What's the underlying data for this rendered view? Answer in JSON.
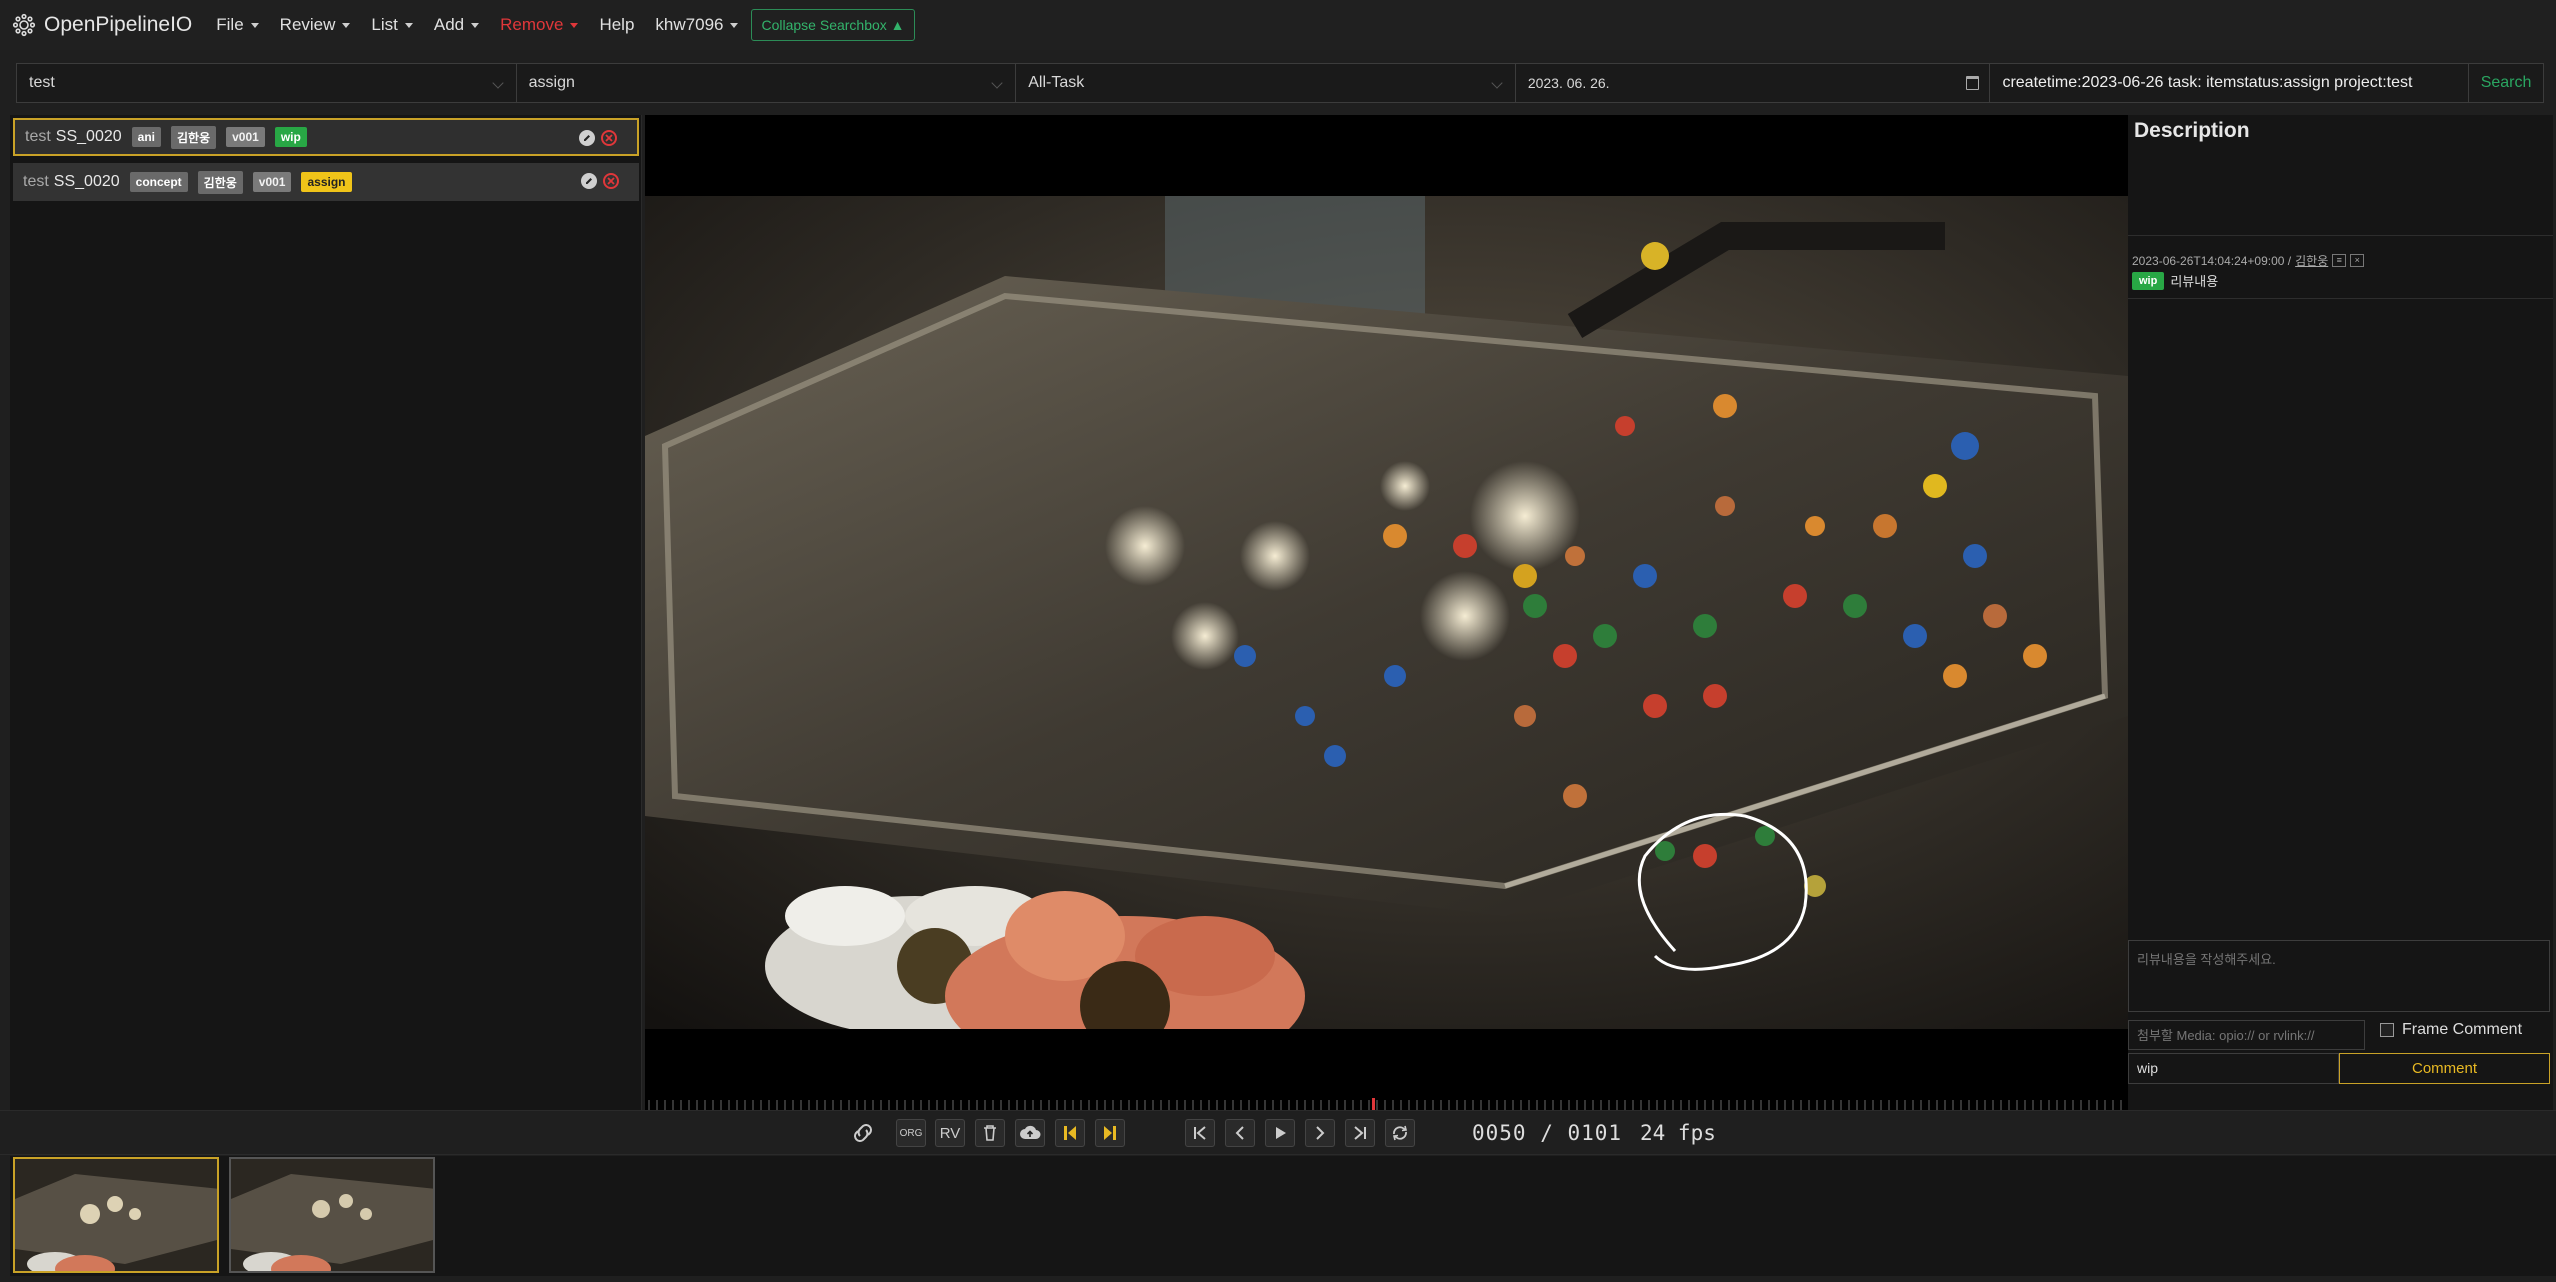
{
  "navbar": {
    "brand": "OpenPipelineIO",
    "menus": [
      {
        "label": "File"
      },
      {
        "label": "Review"
      },
      {
        "label": "List"
      },
      {
        "label": "Add"
      },
      {
        "label": "Remove"
      }
    ],
    "help": "Help",
    "user": "khw7096",
    "collapse": "Collapse Searchbox ▲"
  },
  "search": {
    "project": "test",
    "status": "assign",
    "task": "All-Task",
    "date": "2023. 06. 26.",
    "query": "createtime:2023-06-26 task: itemstatus:assign project:test",
    "button": "Search"
  },
  "tasks": [
    {
      "project": "test",
      "shot": "SS_0020",
      "task": "ani",
      "artist": "김한웅",
      "version": "v001",
      "status": "wip",
      "selected": true
    },
    {
      "project": "test",
      "shot": "SS_0020",
      "task": "concept",
      "artist": "김한웅",
      "version": "v001",
      "status": "assign",
      "selected": false
    }
  ],
  "review": {
    "description_title": "Description",
    "comment": {
      "timestamp": "2023-06-26T14:04:24+09:00 /",
      "author": "김한웅",
      "status": "wip",
      "text": "리뷰내용"
    },
    "textarea_placeholder": "리뷰내용을 작성해주세요.",
    "media_placeholder": "첨부할 Media: opio:// or rvlink://",
    "frame_comment_label": "Frame Comment",
    "status_value": "wip",
    "comment_button": "Comment"
  },
  "playback": {
    "org_label": "ORG",
    "rv_label": "RV",
    "current_frame": "0050",
    "total_frames": "0101",
    "frame_display": "0050 / 0101",
    "fps_display": "24 fps",
    "playhead_fraction": 0.49
  },
  "colors": {
    "accent_gold": "#c9a227",
    "wip_green": "#28a745",
    "assign_yellow": "#f0c419",
    "danger_red": "#e0373a",
    "search_green": "#2aa661"
  }
}
